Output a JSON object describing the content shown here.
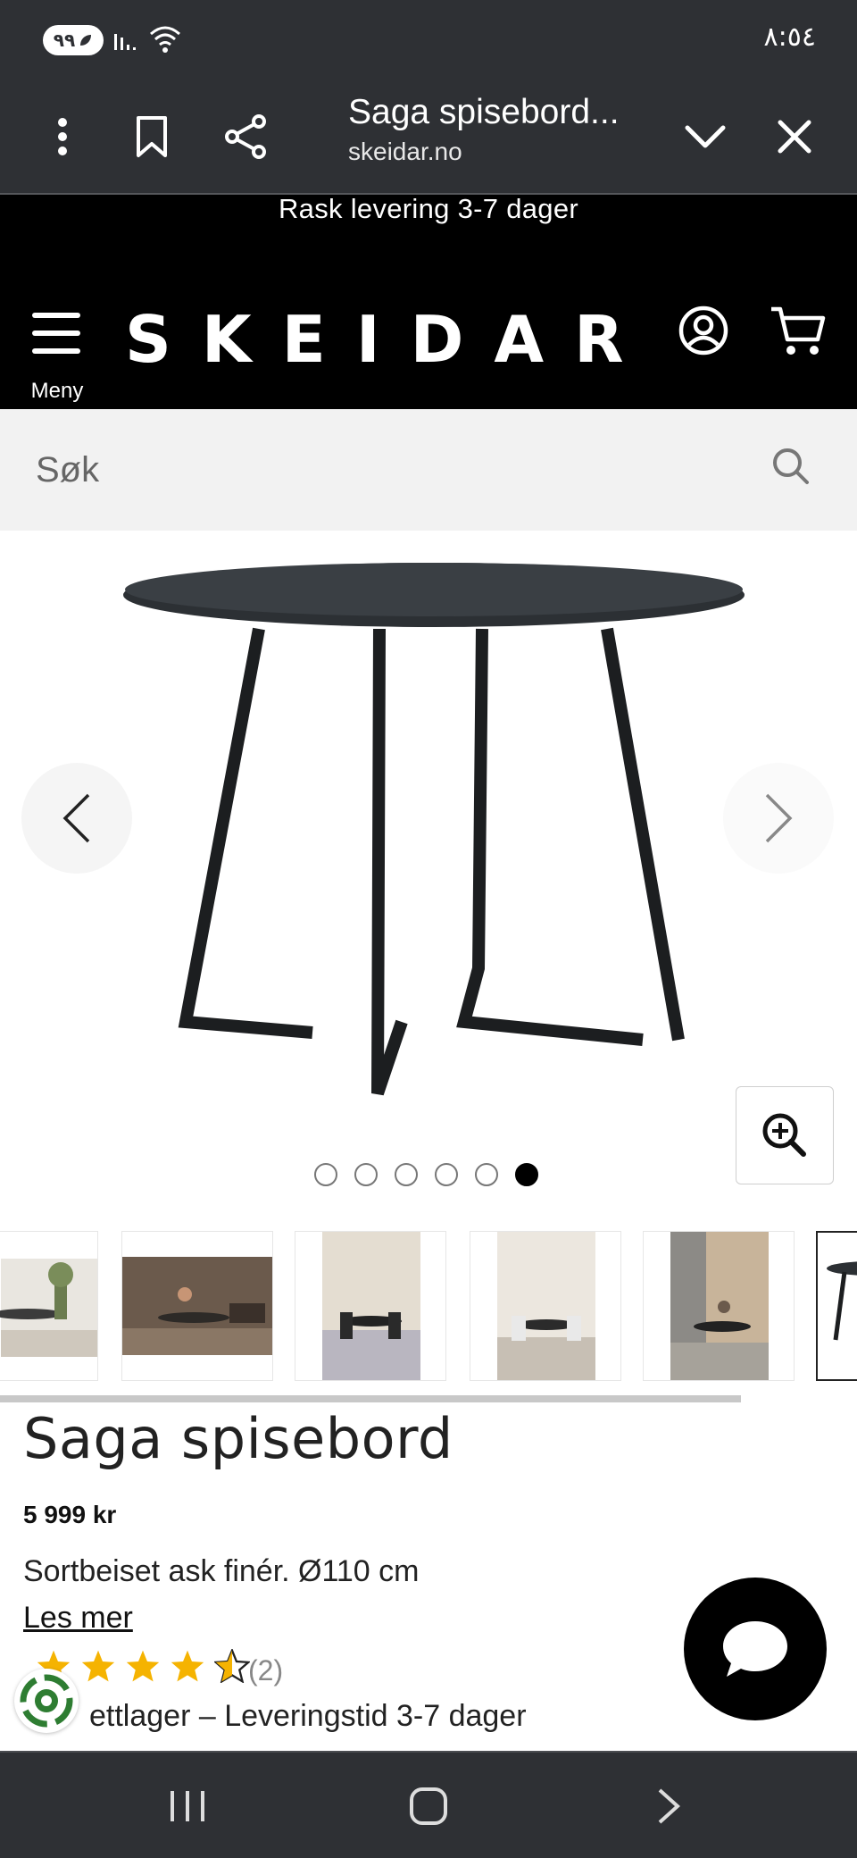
{
  "status_bar": {
    "battery": "٩٩",
    "time": "٨:٥٤"
  },
  "tab": {
    "title": "Saga spisebord...",
    "url": "skeidar.no"
  },
  "promo": {
    "text": "Rask levering 3-7 dager"
  },
  "header": {
    "menu_label": "Meny",
    "logo": "SKEIDAR"
  },
  "search": {
    "placeholder": "Søk"
  },
  "gallery": {
    "total_images": 6,
    "active_index": 6
  },
  "product": {
    "title": "Saga spisebord",
    "price": "5 999 kr",
    "description": "Sortbeiset ask finér. Ø110 cm",
    "read_more": "Les mer",
    "rating": 4.5,
    "review_count": "(2)",
    "stock": "ettlager – Leveringstid 3-7 dager"
  },
  "colors": {
    "system_bar": "#2e3034",
    "header": "#000000",
    "star": "#f5b301",
    "stock_badge": "#2e7d32"
  }
}
